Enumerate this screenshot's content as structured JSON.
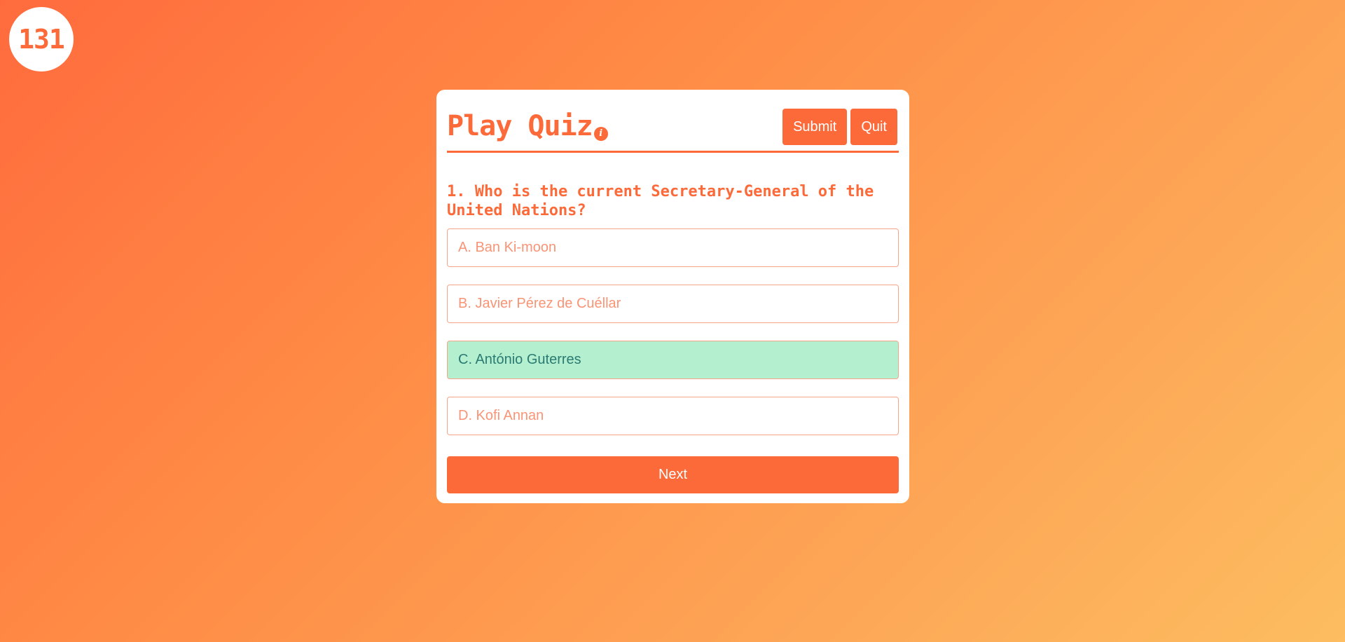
{
  "counter": "131",
  "quiz": {
    "title": "Play Quiz",
    "info_icon_glyph": "i",
    "submit_label": "Submit",
    "quit_label": "Quit",
    "question": "1. Who is the current Secretary-General of the United Nations?",
    "options": [
      {
        "label": "A. Ban Ki-moon",
        "selected": false
      },
      {
        "label": "B. Javier Pérez de Cuéllar",
        "selected": false
      },
      {
        "label": "C. António Guterres",
        "selected": true
      },
      {
        "label": "D. Kofi Annan",
        "selected": false
      }
    ],
    "next_label": "Next"
  },
  "colors": {
    "accent": "#fc6a3a",
    "selected_bg": "#b4f0d0",
    "selected_text": "#2a7a72",
    "option_text": "#f99476",
    "gradient_start": "#ff6b3d",
    "gradient_end": "#fdbd60"
  }
}
